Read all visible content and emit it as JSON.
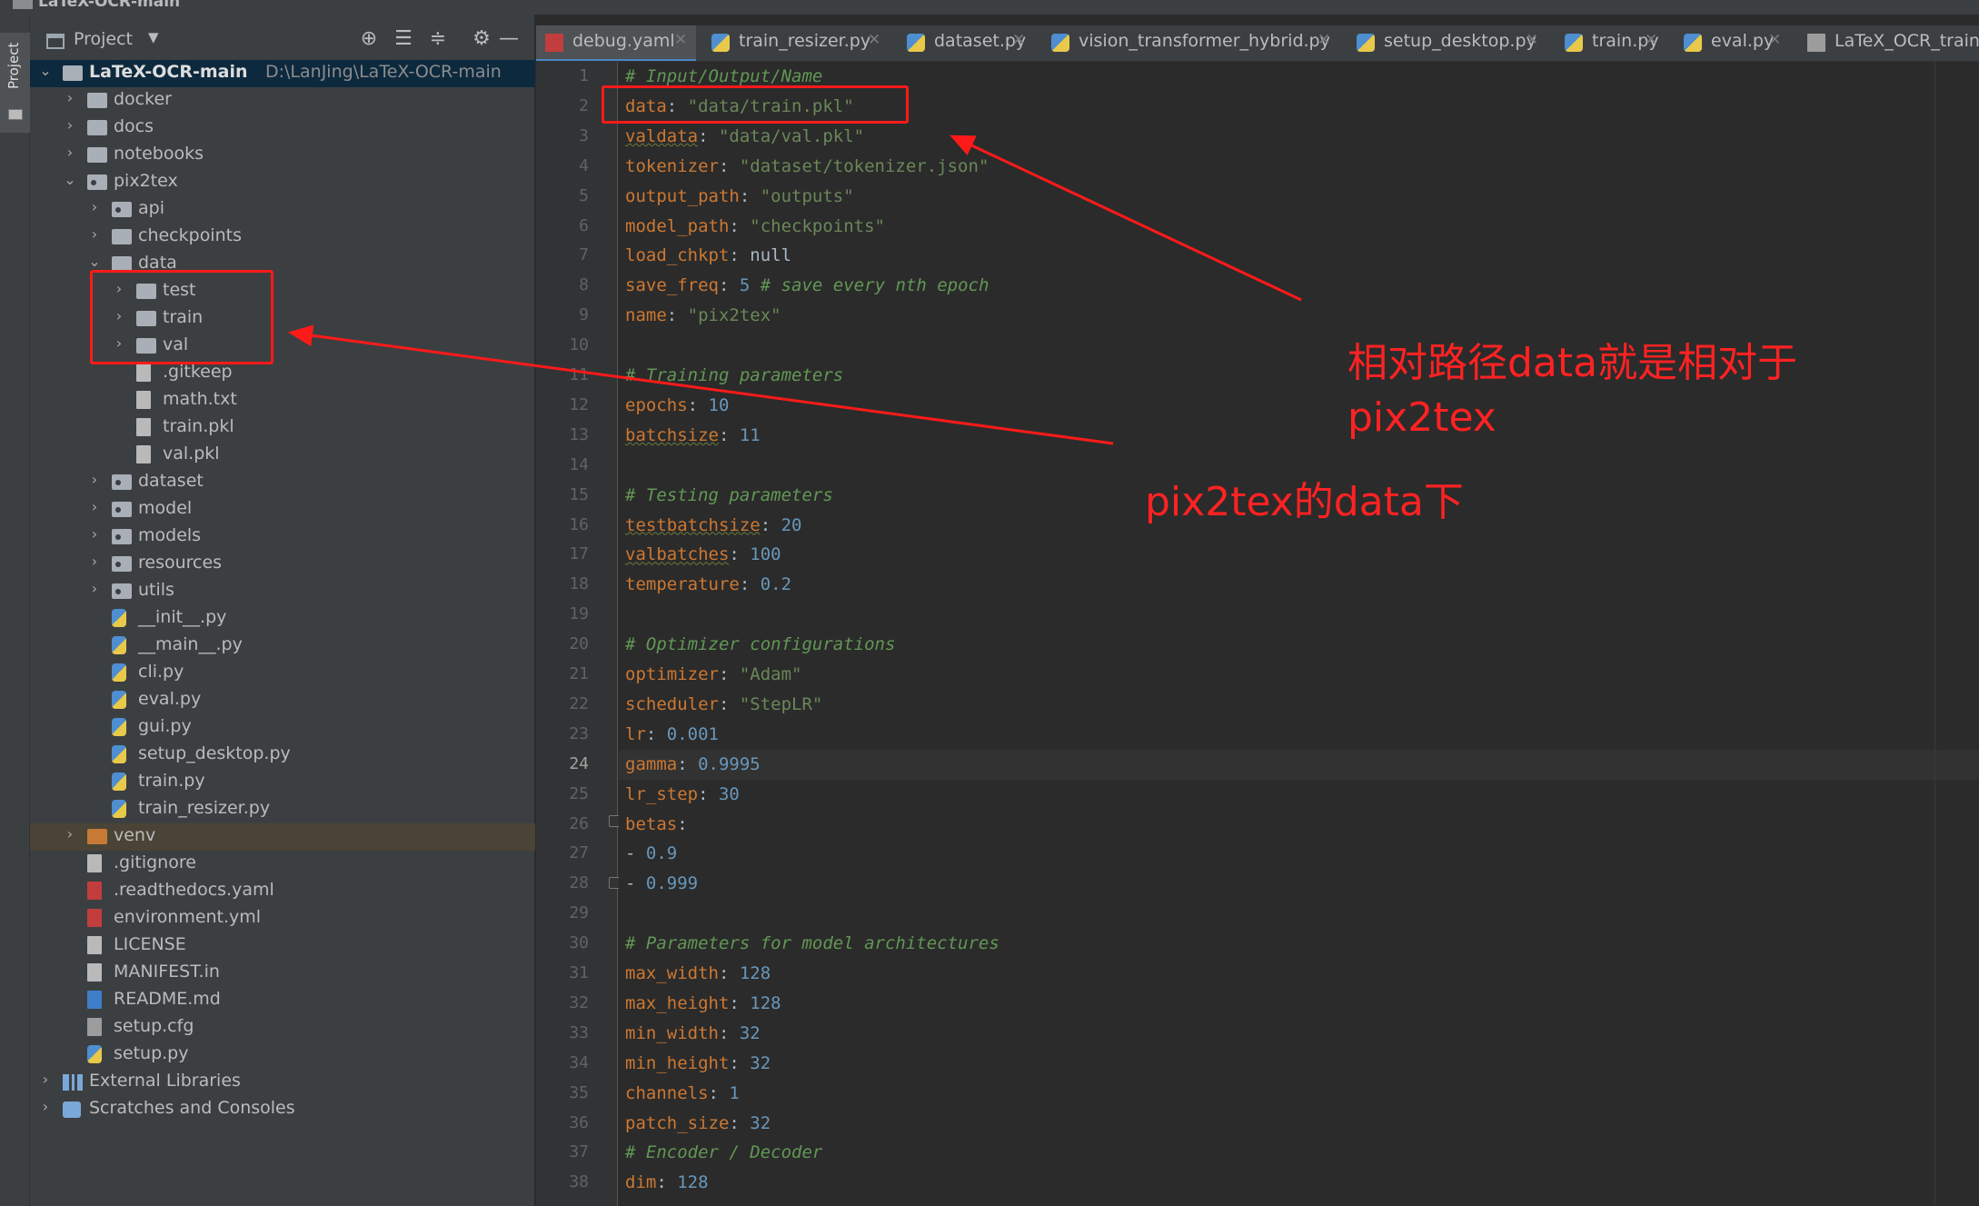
{
  "window": {
    "title": "LaTeX-OCR-main"
  },
  "side_strip": {
    "label": "Project"
  },
  "project_pane": {
    "title": "Project",
    "dropdown_icon": "chevron-down-icon",
    "toolbar_icons": [
      "locate-icon",
      "expand-all-icon",
      "collapse-all-icon",
      "gear-icon",
      "minimize-icon"
    ],
    "root": {
      "name": "LaTeX-OCR-main",
      "path": "D:\\LanJing\\LaTeX-OCR-main"
    },
    "items": [
      {
        "name": "docker",
        "type": "folder"
      },
      {
        "name": "docs",
        "type": "folder"
      },
      {
        "name": "notebooks",
        "type": "folder"
      },
      {
        "name": "pix2tex",
        "type": "package"
      },
      {
        "name": "api",
        "type": "package"
      },
      {
        "name": "checkpoints",
        "type": "folder"
      },
      {
        "name": "data",
        "type": "folder"
      },
      {
        "name": "test",
        "type": "folder"
      },
      {
        "name": "train",
        "type": "folder"
      },
      {
        "name": "val",
        "type": "folder"
      },
      {
        "name": ".gitkeep",
        "type": "file"
      },
      {
        "name": "math.txt",
        "type": "file"
      },
      {
        "name": "train.pkl",
        "type": "file"
      },
      {
        "name": "val.pkl",
        "type": "file"
      },
      {
        "name": "dataset",
        "type": "package"
      },
      {
        "name": "model",
        "type": "package"
      },
      {
        "name": "models",
        "type": "package"
      },
      {
        "name": "resources",
        "type": "package"
      },
      {
        "name": "utils",
        "type": "package"
      },
      {
        "name": "__init__.py",
        "type": "python"
      },
      {
        "name": "__main__.py",
        "type": "python"
      },
      {
        "name": "cli.py",
        "type": "python"
      },
      {
        "name": "eval.py",
        "type": "python"
      },
      {
        "name": "gui.py",
        "type": "python"
      },
      {
        "name": "setup_desktop.py",
        "type": "python"
      },
      {
        "name": "train.py",
        "type": "python"
      },
      {
        "name": "train_resizer.py",
        "type": "python"
      },
      {
        "name": "venv",
        "type": "folder"
      },
      {
        "name": ".gitignore",
        "type": "file"
      },
      {
        "name": ".readthedocs.yaml",
        "type": "yaml"
      },
      {
        "name": "environment.yml",
        "type": "yaml"
      },
      {
        "name": "LICENSE",
        "type": "file"
      },
      {
        "name": "MANIFEST.in",
        "type": "file"
      },
      {
        "name": "README.md",
        "type": "markdown"
      },
      {
        "name": "setup.cfg",
        "type": "config"
      },
      {
        "name": "setup.py",
        "type": "python"
      },
      {
        "name": "External Libraries",
        "type": "libraries"
      },
      {
        "name": "Scratches and Consoles",
        "type": "scratches"
      }
    ]
  },
  "tabs": [
    {
      "label": "debug.yaml",
      "icon": "yaml-file-icon",
      "active": true
    },
    {
      "label": "train_resizer.py",
      "icon": "python-file-icon",
      "active": false
    },
    {
      "label": "dataset.py",
      "icon": "python-file-icon",
      "active": false
    },
    {
      "label": "vision_transformer_hybrid.py",
      "icon": "python-file-icon",
      "active": false
    },
    {
      "label": "setup_desktop.py",
      "icon": "python-file-icon",
      "active": false
    },
    {
      "label": "train.py",
      "icon": "python-file-icon",
      "active": false
    },
    {
      "label": "eval.py",
      "icon": "python-file-icon",
      "active": false
    },
    {
      "label": "LaTeX_OCR_training",
      "icon": "notebook-file-icon",
      "active": false
    }
  ],
  "editor": {
    "current_line": 24,
    "lines": [
      {
        "n": "1",
        "text": "# Input/Output/Name"
      },
      {
        "n": "2",
        "text": "data: \"data/train.pkl\""
      },
      {
        "n": "3",
        "text": "valdata: \"data/val.pkl\""
      },
      {
        "n": "4",
        "text": "tokenizer: \"dataset/tokenizer.json\""
      },
      {
        "n": "5",
        "text": "output_path: \"outputs\""
      },
      {
        "n": "6",
        "text": "model_path: \"checkpoints\""
      },
      {
        "n": "7",
        "text": "load_chkpt: null"
      },
      {
        "n": "8",
        "text": "save_freq: 5 # save every nth epoch"
      },
      {
        "n": "9",
        "text": "name: \"pix2tex\""
      },
      {
        "n": "10",
        "text": ""
      },
      {
        "n": "11",
        "text": "# Training parameters"
      },
      {
        "n": "12",
        "text": "epochs: 10"
      },
      {
        "n": "13",
        "text": "batchsize: 11"
      },
      {
        "n": "14",
        "text": ""
      },
      {
        "n": "15",
        "text": "# Testing parameters"
      },
      {
        "n": "16",
        "text": "testbatchsize: 20"
      },
      {
        "n": "17",
        "text": "valbatches: 100"
      },
      {
        "n": "18",
        "text": "temperature: 0.2"
      },
      {
        "n": "19",
        "text": ""
      },
      {
        "n": "20",
        "text": "# Optimizer configurations"
      },
      {
        "n": "21",
        "text": "optimizer: \"Adam\""
      },
      {
        "n": "22",
        "text": "scheduler: \"StepLR\""
      },
      {
        "n": "23",
        "text": "lr: 0.001"
      },
      {
        "n": "24",
        "text": "gamma: 0.9995"
      },
      {
        "n": "25",
        "text": "lr_step: 30"
      },
      {
        "n": "26",
        "text": "betas:"
      },
      {
        "n": "27",
        "text": "- 0.9"
      },
      {
        "n": "28",
        "text": "- 0.999"
      },
      {
        "n": "29",
        "text": ""
      },
      {
        "n": "30",
        "text": "# Parameters for model architectures"
      },
      {
        "n": "31",
        "text": "max_width: 128"
      },
      {
        "n": "32",
        "text": "max_height: 128"
      },
      {
        "n": "33",
        "text": "min_width: 32"
      },
      {
        "n": "34",
        "text": "min_height: 32"
      },
      {
        "n": "35",
        "text": "channels: 1"
      },
      {
        "n": "36",
        "text": "patch_size: 32"
      },
      {
        "n": "37",
        "text": "# Encoder / Decoder"
      },
      {
        "n": "38",
        "text": "dim: 128"
      }
    ]
  },
  "annotations": {
    "note1_line1": "相对路径data就是相对于",
    "note1_line2": "pix2tex",
    "note2": "pix2tex的data下",
    "color": "#ff1a1a"
  }
}
